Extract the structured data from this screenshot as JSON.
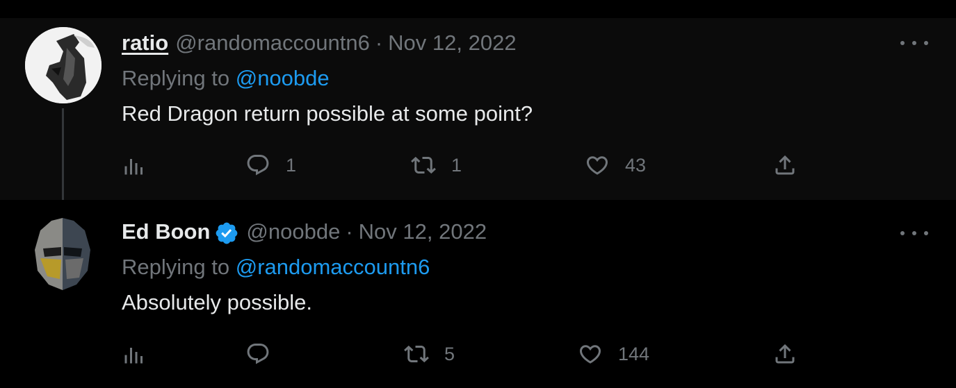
{
  "tweets": [
    {
      "display_name": "ratio",
      "handle": "@randomaccountn6",
      "separator": "·",
      "date": "Nov 12, 2022",
      "replying_prefix": "Replying to ",
      "replying_to": "@noobde",
      "text": "Red Dragon return possible at some point?",
      "verified": false,
      "stats": {
        "replies": "1",
        "retweets": "1",
        "likes": "43"
      }
    },
    {
      "display_name": "Ed Boon",
      "handle": "@noobde",
      "separator": "·",
      "date": "Nov 12, 2022",
      "replying_prefix": "Replying to ",
      "replying_to": "@randomaccountn6",
      "text": "Absolutely possible.",
      "verified": true,
      "stats": {
        "replies": "",
        "retweets": "5",
        "likes": "144"
      }
    }
  ],
  "colors": {
    "background": "#000000",
    "thread_background": "#0b0b0b",
    "primary_text": "#e7e9ea",
    "secondary_text": "#71767b",
    "accent": "#1d9bf0"
  },
  "icons": {
    "views": "bar-chart-icon",
    "reply": "speech-bubble-icon",
    "retweet": "retweet-arrows-icon",
    "like": "heart-icon",
    "share": "upload-arrow-icon",
    "more": "ellipsis-icon",
    "verified": "verified-badge-icon"
  }
}
